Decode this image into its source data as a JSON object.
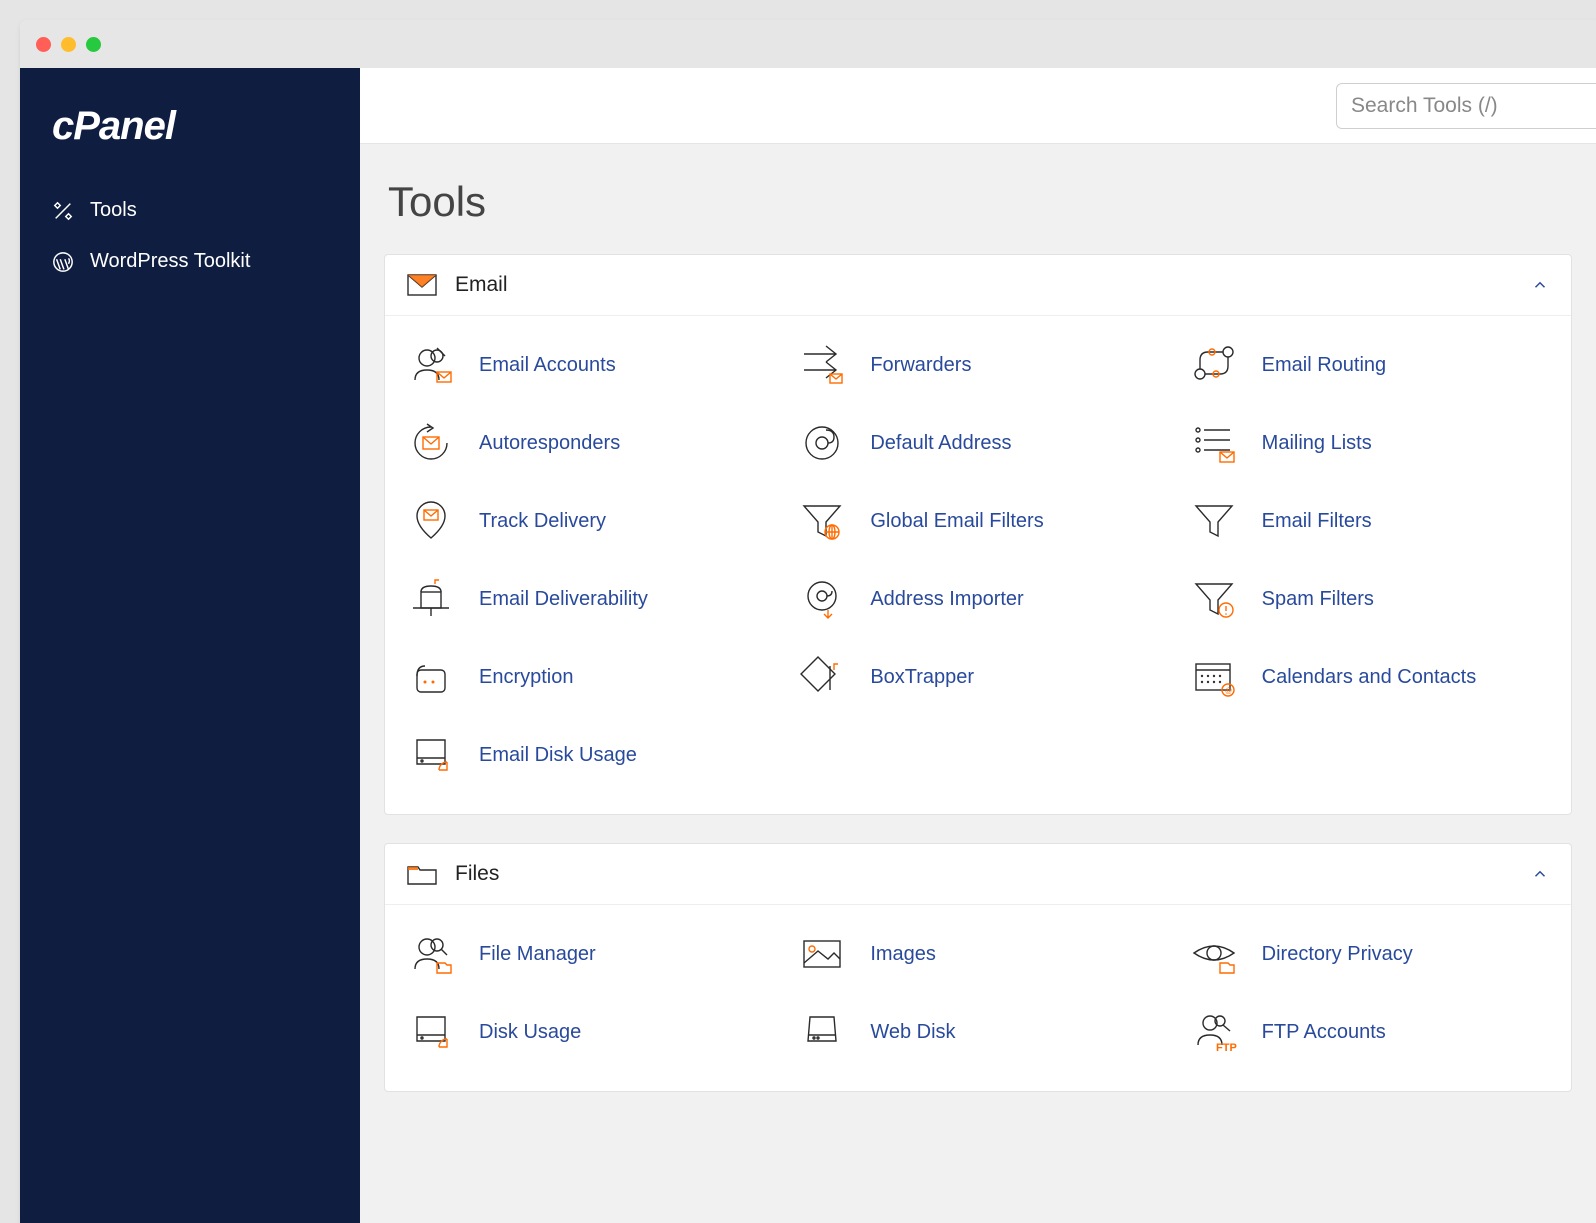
{
  "brand": "cPanel",
  "sidebar": {
    "items": [
      {
        "label": "Tools"
      },
      {
        "label": "WordPress Toolkit"
      }
    ]
  },
  "search": {
    "placeholder": "Search Tools (/)"
  },
  "page": {
    "title": "Tools"
  },
  "sections": {
    "email": {
      "title": "Email",
      "items": [
        "Email Accounts",
        "Forwarders",
        "Email Routing",
        "Autoresponders",
        "Default Address",
        "Mailing Lists",
        "Track Delivery",
        "Global Email Filters",
        "Email Filters",
        "Email Deliverability",
        "Address Importer",
        "Spam Filters",
        "Encryption",
        "BoxTrapper",
        "Calendars and Contacts",
        "Email Disk Usage"
      ]
    },
    "files": {
      "title": "Files",
      "items": [
        "File Manager",
        "Images",
        "Directory Privacy",
        "Disk Usage",
        "Web Disk",
        "FTP Accounts"
      ]
    }
  }
}
